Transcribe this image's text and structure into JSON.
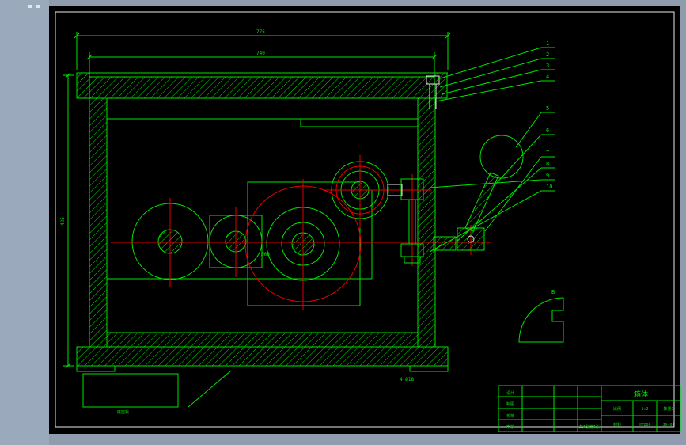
{
  "colors": {
    "background": "#8e9cae",
    "left_panel": "#9aa9bb",
    "canvas": "#000000",
    "line_green": "#00e400",
    "line_red": "#e60000",
    "line_white": "#e9e9e9"
  },
  "dims": {
    "top_outer": "776",
    "top_inner": "740",
    "left_height": "425",
    "bottom_note": "4-Ø18",
    "hub_note": "Ø60"
  },
  "callouts": [
    "1",
    "2",
    "3",
    "4",
    "5",
    "6",
    "7",
    "8",
    "9",
    "10"
  ],
  "detail": {
    "label": "B"
  },
  "base_box": {
    "label": "底座板"
  },
  "title_block": {
    "rows": [
      "设计",
      "制图",
      "校核",
      "审核"
    ],
    "title": "箱体",
    "scale_label": "比例",
    "scale": "1:2",
    "qty": "数量1",
    "material_label": "材料",
    "material": "HT200",
    "no": "JX-01",
    "sheets": "共1张第1张"
  }
}
